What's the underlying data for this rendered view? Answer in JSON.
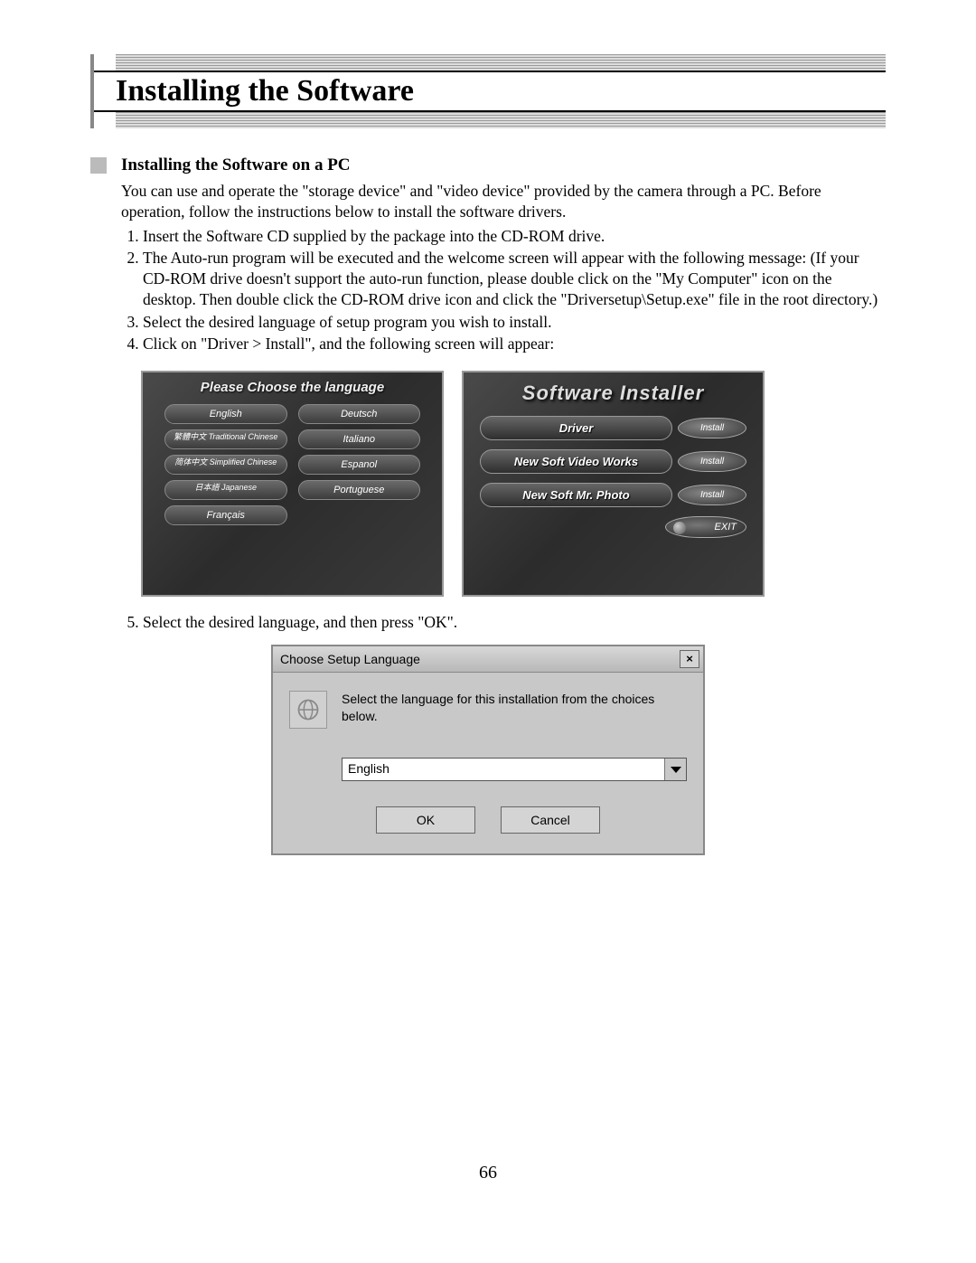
{
  "page_title": "Installing the Software",
  "section_heading": "Installing the Software on a PC",
  "intro": "You can use and operate the \"storage device\" and \"video device\" provided by the camera through a PC. Before operation, follow the instructions below to install the software drivers.",
  "steps": [
    "Insert the Software CD supplied by the package into the CD-ROM drive.",
    "The Auto-run program will be executed and the welcome screen will appear with the following message: (If your CD-ROM drive doesn't support the auto-run function, please double click on the \"My Computer\" icon on the desktop. Then double click the CD-ROM drive icon and click the \"Driversetup\\Setup.exe\" file in the root directory.)",
    "Select the desired language of setup program you wish to install.",
    "Click on \"Driver > Install\", and the following screen will appear:"
  ],
  "lang_screen": {
    "title": "Please Choose the language",
    "buttons": [
      "English",
      "Deutsch",
      "繁體中文 Traditional Chinese",
      "Italiano",
      "简体中文 Simplified Chinese",
      "Espanol",
      "日本語 Japanese",
      "Portuguese",
      "Français"
    ]
  },
  "installer_screen": {
    "title": "Software Installer",
    "rows": [
      {
        "product": "Driver",
        "action": "Install"
      },
      {
        "product": "New Soft Video Works",
        "action": "Install"
      },
      {
        "product": "New Soft Mr. Photo",
        "action": "Install"
      }
    ],
    "exit": "EXIT"
  },
  "step5": "Select the desired language, and then press \"OK\".",
  "dialog": {
    "title": "Choose Setup Language",
    "close": "×",
    "message": "Select the language for this installation from the choices below.",
    "selected": "English",
    "ok": "OK",
    "cancel": "Cancel"
  },
  "page_number": "66"
}
